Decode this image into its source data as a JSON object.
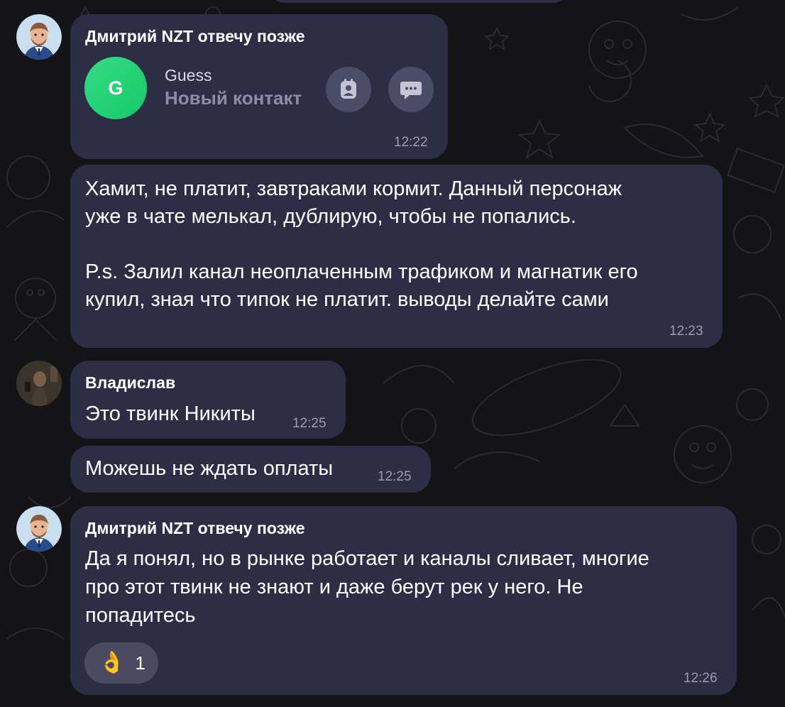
{
  "colors": {
    "background": "#141417",
    "bubble": "#2d2e45",
    "time": "#9b9cb5",
    "contact_avatar": "#1fd273",
    "circle_button": "#4b4c65"
  },
  "messages": [
    {
      "sender": "Дмитрий NZT отвечу позже",
      "avatar_icon": "cartoon-man-avatar",
      "contact": {
        "initial": "G",
        "name": "Guess",
        "subtitle": "Новый контакт",
        "buttons": [
          "contact-card-icon",
          "message-icon"
        ]
      },
      "time": "12:22"
    },
    {
      "lines": [
        "Хамит, не платит, завтраками кормит. Данный персонаж",
        "уже в чате мелькал, дублирую, чтобы не попались.",
        "",
        "P.s. Залил канал неоплаченным трафиком и магнатик его",
        "купил, зная что типок не платит. выводы делайте сами"
      ],
      "time": "12:23"
    },
    {
      "sender": "Владислав",
      "avatar_icon": "photo-avatar",
      "text": "Это твинк Никиты",
      "time": "12:25"
    },
    {
      "text": "Можешь не ждать оплаты",
      "time": "12:25"
    },
    {
      "sender": "Дмитрий NZT отвечу позже",
      "avatar_icon": "cartoon-man-avatar",
      "lines": [
        "Да я понял, но в рынке работает и каналы сливает, многие",
        "про этот твинк не знают и даже берут рек у него. Не",
        "попадитесь"
      ],
      "reaction": {
        "emoji": "👌",
        "count": "1"
      },
      "time": "12:26"
    }
  ]
}
